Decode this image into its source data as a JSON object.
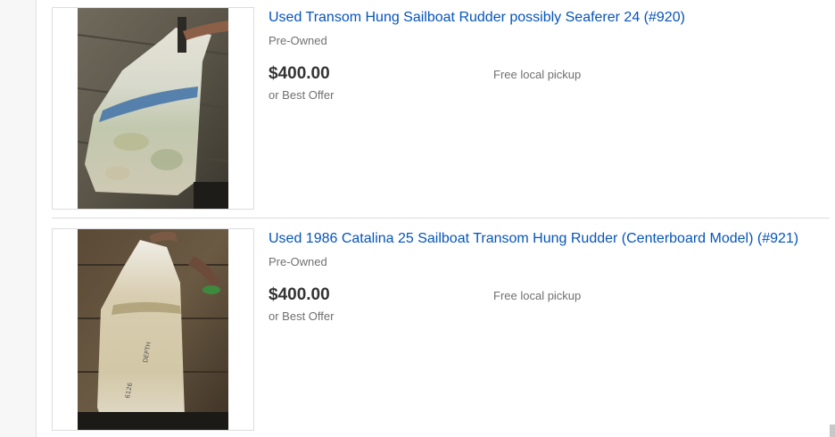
{
  "listings": [
    {
      "title": "Used Transom Hung Sailboat Rudder possibly Seaferer 24 (#920)",
      "condition": "Pre-Owned",
      "price": "$400.00",
      "offer": "or Best Offer",
      "shipping": "Free local pickup"
    },
    {
      "title": "Used 1986 Catalina 25 Sailboat Transom Hung Rudder (Centerboard Model) (#921)",
      "condition": "Pre-Owned",
      "price": "$400.00",
      "offer": "or Best Offer",
      "shipping": "Free local pickup"
    }
  ]
}
